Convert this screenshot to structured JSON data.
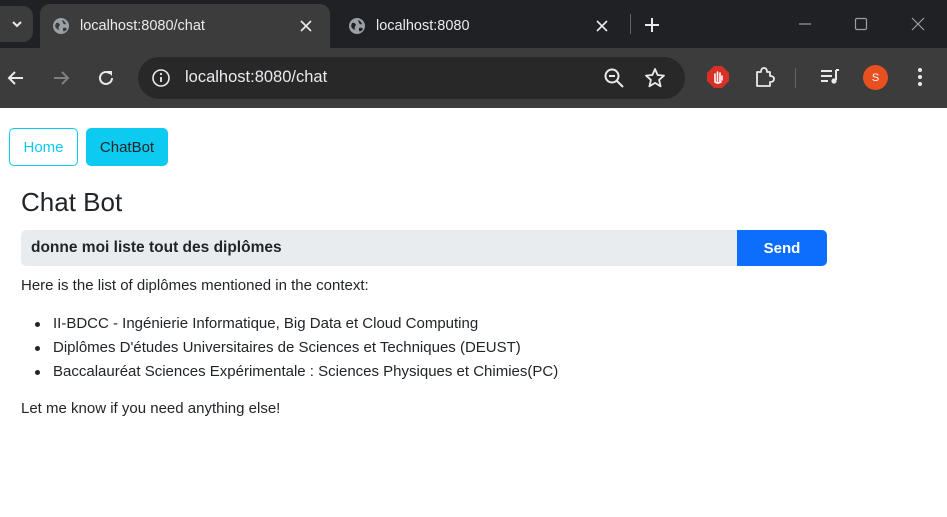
{
  "browser": {
    "tabs": [
      {
        "title": "localhost:8080/chat",
        "active": true
      },
      {
        "title": "localhost:8080",
        "active": false
      }
    ],
    "address_bar": {
      "url": "localhost:8080/chat"
    },
    "profile_initial": "S"
  },
  "nav": {
    "home_label": "Home",
    "chatbot_label": "ChatBot"
  },
  "chat": {
    "heading": "Chat Bot",
    "input_value": "donne moi liste tout des diplômes",
    "send_label": "Send",
    "response": {
      "intro": "Here is the list of diplômes mentioned in the context:",
      "items": [
        "II-BDCC - Ingénierie Informatique, Big Data et Cloud Computing",
        "Diplômes D'études Universitaires de Sciences et Techniques (DEUST)",
        "Baccalauréat Sciences Expérimentale : Sciences Physiques et Chimies(PC)"
      ],
      "outro": "Let me know if you need anything else!"
    }
  },
  "colors": {
    "info": "#0dcaf0",
    "primary": "#0d6efd",
    "chrome_dark": "#202124",
    "chrome_toolbar": "#3c3c3c"
  }
}
